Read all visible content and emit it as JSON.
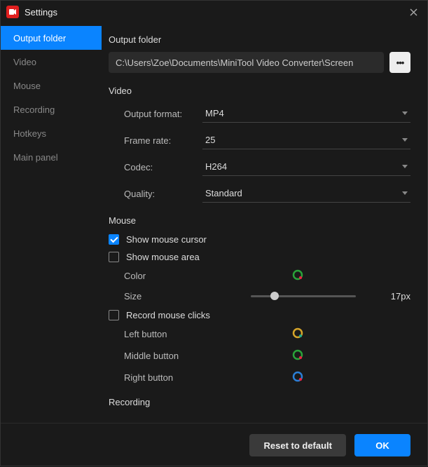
{
  "titlebar": {
    "label": "Settings"
  },
  "sidebar": {
    "items": [
      {
        "label": "Output folder",
        "active": true
      },
      {
        "label": "Video"
      },
      {
        "label": "Mouse"
      },
      {
        "label": "Recording"
      },
      {
        "label": "Hotkeys"
      },
      {
        "label": "Main panel"
      }
    ]
  },
  "output": {
    "title": "Output folder",
    "path": "C:\\Users\\Zoe\\Documents\\MiniTool Video Converter\\Screen"
  },
  "video": {
    "title": "Video",
    "format_label": "Output format:",
    "format_value": "MP4",
    "framerate_label": "Frame rate:",
    "framerate_value": "25",
    "codec_label": "Codec:",
    "codec_value": "H264",
    "quality_label": "Quality:",
    "quality_value": "Standard"
  },
  "mouse": {
    "title": "Mouse",
    "show_cursor": "Show mouse cursor",
    "show_area": "Show mouse area",
    "color_label": "Color",
    "size_label": "Size",
    "size_value": "17px",
    "record_clicks": "Record mouse clicks",
    "left_label": "Left button",
    "middle_label": "Middle button",
    "right_label": "Right button"
  },
  "recording": {
    "title": "Recording"
  },
  "footer": {
    "reset": "Reset to default",
    "ok": "OK"
  }
}
